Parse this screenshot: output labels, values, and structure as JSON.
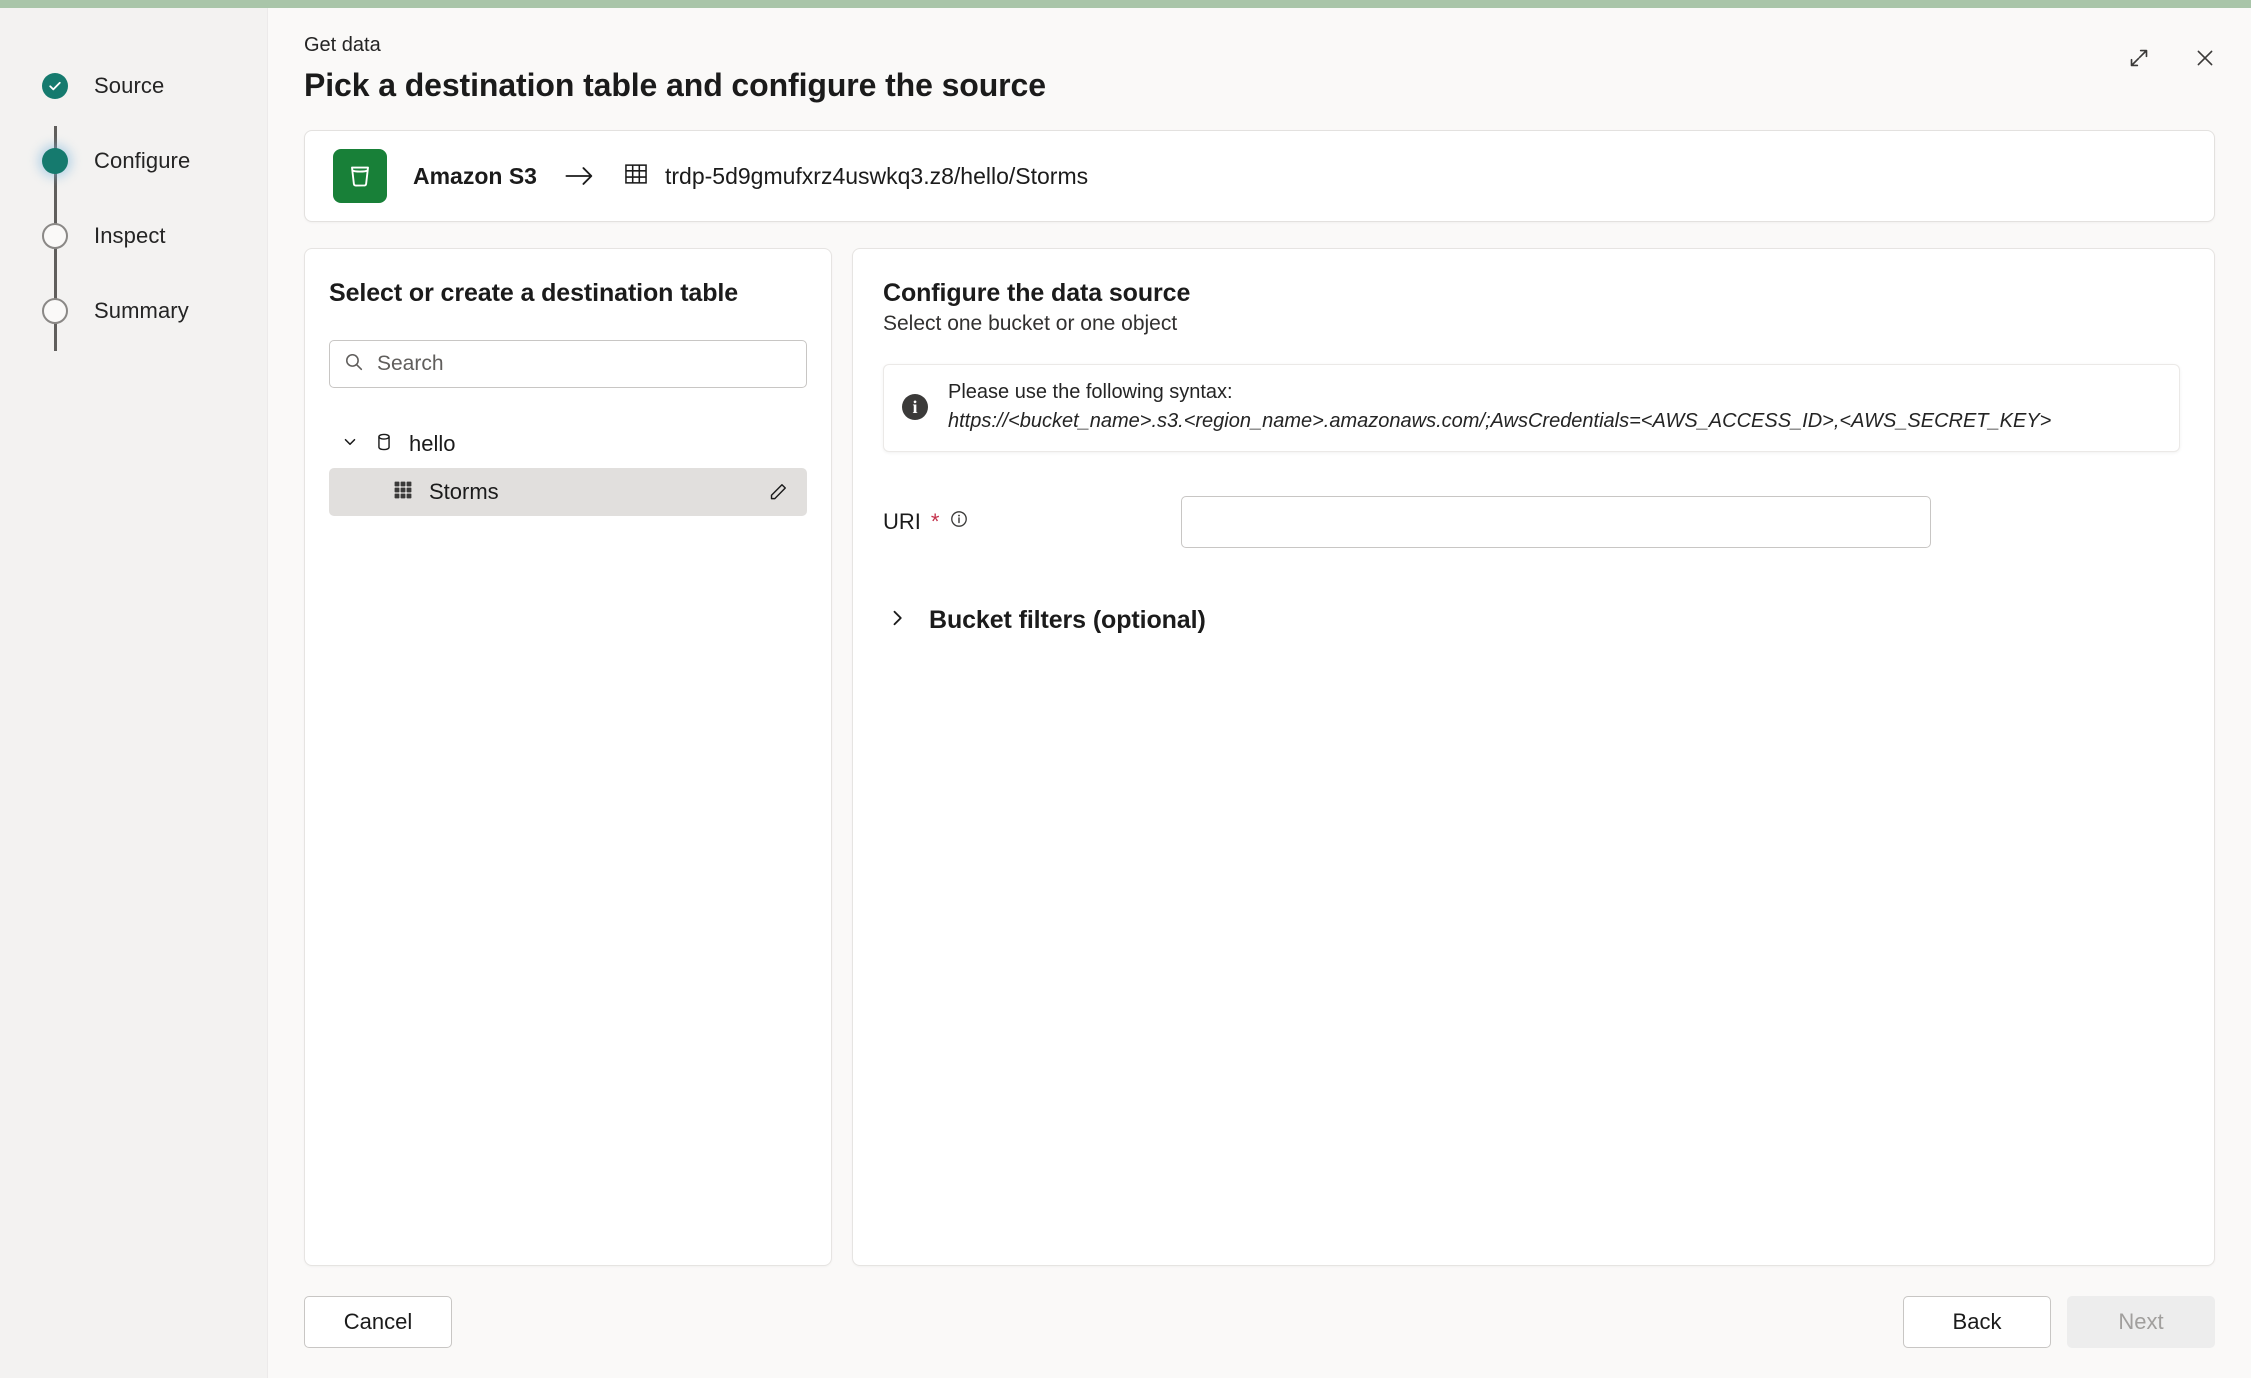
{
  "window": {
    "expand_icon": "expand-diagonal-icon",
    "close_icon": "close-icon"
  },
  "header": {
    "eyebrow": "Get data",
    "title": "Pick a destination table and configure the source"
  },
  "stepper": {
    "steps": [
      {
        "label": "Source",
        "state": "done"
      },
      {
        "label": "Configure",
        "state": "current"
      },
      {
        "label": "Inspect",
        "state": "todo"
      },
      {
        "label": "Summary",
        "state": "todo"
      }
    ]
  },
  "pathbar": {
    "source_icon": "s3-bucket-icon",
    "source_label": "Amazon S3",
    "arrow_icon": "arrow-right-icon",
    "dest_icon": "table-grid-icon",
    "dest_path": "trdp-5d9gmufxrz4uswkq3.z8/hello/Storms"
  },
  "left_panel": {
    "title": "Select or create a destination table",
    "search": {
      "icon": "search-icon",
      "placeholder": "Search",
      "value": ""
    },
    "tree": [
      {
        "label": "hello",
        "type": "database",
        "icon": "database-icon",
        "chevron": "chevron-down-icon",
        "expanded": true,
        "children": [
          {
            "label": "Storms",
            "type": "table",
            "icon": "table-grid-icon",
            "selected": true,
            "edit_icon": "pencil-edit-icon"
          }
        ]
      }
    ]
  },
  "right_panel": {
    "title": "Configure the data source",
    "subtitle": "Select one bucket or one object",
    "callout": {
      "icon": "info-icon",
      "line1": "Please use the following syntax:",
      "line2": "https://<bucket_name>.s3.<region_name>.amazonaws.com/;AwsCredentials=<AWS_ACCESS_ID>,<AWS_SECRET_KEY>"
    },
    "uri_field": {
      "label": "URI",
      "required_marker": "*",
      "info_icon": "info-outline-icon",
      "value": "",
      "placeholder": ""
    },
    "bucket_filters": {
      "chevron": "chevron-right-icon",
      "label": "Bucket filters (optional)",
      "expanded": false
    }
  },
  "footer": {
    "cancel_label": "Cancel",
    "back_label": "Back",
    "next_label": "Next",
    "next_disabled": true
  },
  "colors": {
    "accent_teal": "#157a6e",
    "s3_green": "#188038",
    "required_red": "#c4314b",
    "top_border_green": "#a9c5a9"
  }
}
